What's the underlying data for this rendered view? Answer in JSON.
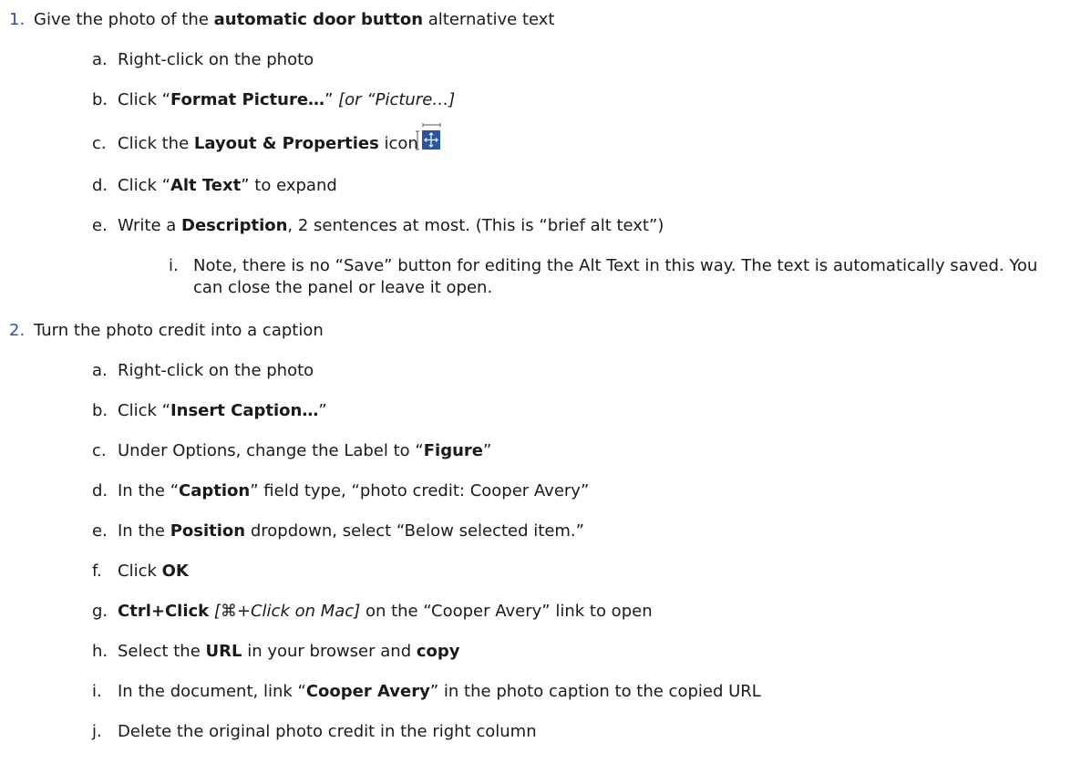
{
  "items": [
    {
      "num": "1.",
      "parts": [
        {
          "t": "Give the photo of the ",
          "s": "n"
        },
        {
          "t": "automatic door button",
          "s": "b"
        },
        {
          "t": " alternative text",
          "s": "n"
        }
      ],
      "sub": [
        {
          "letter": "a.",
          "parts": [
            {
              "t": "Right-click on the photo",
              "s": "n"
            }
          ]
        },
        {
          "letter": "b.",
          "parts": [
            {
              "t": "Click “",
              "s": "n"
            },
            {
              "t": "Format Picture…",
              "s": "b"
            },
            {
              "t": "” ",
              "s": "n"
            },
            {
              "t": "[or “Picture…]",
              "s": "i"
            }
          ]
        },
        {
          "letter": "c.",
          "parts": [
            {
              "t": "Click the ",
              "s": "n"
            },
            {
              "t": "Layout & Properties",
              "s": "b"
            },
            {
              "t": " icon",
              "s": "n"
            }
          ],
          "icon": "layout-properties-icon"
        },
        {
          "letter": "d.",
          "parts": [
            {
              "t": "Click “",
              "s": "n"
            },
            {
              "t": "Alt Text",
              "s": "b"
            },
            {
              "t": "” to expand",
              "s": "n"
            }
          ]
        },
        {
          "letter": "e.",
          "parts": [
            {
              "t": "Write a ",
              "s": "n"
            },
            {
              "t": "Description",
              "s": "b"
            },
            {
              "t": ", 2 sentences at most. (This is “brief alt text”)",
              "s": "n"
            }
          ],
          "sub": [
            {
              "letter": "i.",
              "parts": [
                {
                  "t": "Note, there is no “Save” button for editing the Alt Text in this way. The text is automatically saved. You can close the panel or leave it open.",
                  "s": "n"
                }
              ]
            }
          ]
        }
      ]
    },
    {
      "num": "2.",
      "parts": [
        {
          "t": "Turn the photo credit into a caption",
          "s": "n"
        }
      ],
      "sub": [
        {
          "letter": "a.",
          "parts": [
            {
              "t": "Right-click on the photo",
              "s": "n"
            }
          ]
        },
        {
          "letter": "b.",
          "parts": [
            {
              "t": "Click “",
              "s": "n"
            },
            {
              "t": "Insert Caption…",
              "s": "b"
            },
            {
              "t": "”",
              "s": "n"
            }
          ]
        },
        {
          "letter": "c.",
          "parts": [
            {
              "t": "Under Options, change the Label to “",
              "s": "n"
            },
            {
              "t": "Figure",
              "s": "b"
            },
            {
              "t": "”",
              "s": "n"
            }
          ]
        },
        {
          "letter": "d.",
          "parts": [
            {
              "t": "In the “",
              "s": "n"
            },
            {
              "t": "Caption",
              "s": "b"
            },
            {
              "t": "” field type, “photo credit: Cooper Avery”",
              "s": "n"
            }
          ]
        },
        {
          "letter": "e.",
          "parts": [
            {
              "t": "In the ",
              "s": "n"
            },
            {
              "t": "Position",
              "s": "b"
            },
            {
              "t": " dropdown, select “Below selected item.”",
              "s": "n"
            }
          ]
        },
        {
          "letter": "f.",
          "parts": [
            {
              "t": "Click ",
              "s": "n"
            },
            {
              "t": "OK",
              "s": "b"
            }
          ]
        },
        {
          "letter": "g.",
          "parts": [
            {
              "t": "Ctrl+Click",
              "s": "b"
            },
            {
              "t": " ",
              "s": "n"
            },
            {
              "t": "[⌘+Click on Mac]",
              "s": "i"
            },
            {
              "t": " on the “Cooper Avery” link to open",
              "s": "n"
            }
          ]
        },
        {
          "letter": "h.",
          "parts": [
            {
              "t": "Select the ",
              "s": "n"
            },
            {
              "t": "URL",
              "s": "b"
            },
            {
              "t": " in your browser and ",
              "s": "n"
            },
            {
              "t": "copy",
              "s": "b"
            }
          ]
        },
        {
          "letter": "i.",
          "parts": [
            {
              "t": "In the document, link “",
              "s": "n"
            },
            {
              "t": "Cooper Avery",
              "s": "b"
            },
            {
              "t": "” in the photo caption to the copied URL",
              "s": "n"
            }
          ]
        },
        {
          "letter": "j.",
          "parts": [
            {
              "t": "Delete the original photo credit in the right column",
              "s": "n"
            }
          ]
        }
      ]
    }
  ],
  "colors": {
    "list_number": "#2f5597",
    "text": "#1a1a1a",
    "icon_blue": "#2b579a"
  }
}
